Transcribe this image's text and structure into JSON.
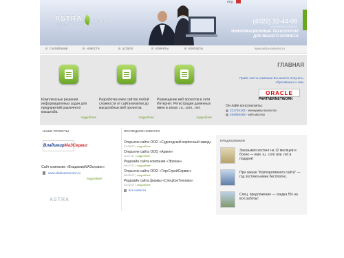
{
  "header": {
    "logo_main": "ASTRA",
    "logo_sub": "COMPANY",
    "logo_systems": "systems",
    "top_icons": [
      "eng"
    ],
    "phone": "(4922) 32-44-09",
    "phone_caption": "контактный телефон",
    "slogan": "ИНФОРМАЦИОННЫЕ ТЕХНОЛОГИИ ДЛЯ ВАШЕГО БИЗНЕСА",
    "site_url": "www.astra-systems.ru"
  },
  "nav": {
    "items": [
      "о компании",
      "новости",
      "услуги",
      "клиенты",
      "контакты"
    ]
  },
  "services": [
    {
      "text": "Комплексные решения информационных задач для предприятий различного масштаба.",
      "more": "подробнее"
    },
    {
      "text": "Разработка www сайтов любой сложности от сайта-визитки до масштабных веб проектов.",
      "more": "подробнее"
    },
    {
      "text": "Размещение веб проектов в сети Интернет. Регистрация доменных имен в зонах .ru, .com, .net.",
      "more": "подробнее"
    }
  ],
  "sidebar": {
    "title": "ГЛАВНАЯ",
    "price_link": "Прайс листы компании Вы можете получить, обратившись к нам.",
    "oracle": "ORACLE",
    "partner": "PARTNERNETWORK",
    "online_title": "Он-лайн консультанты:",
    "contacts": [
      {
        "number": "321746183",
        "role": " - менеджер проектов"
      },
      {
        "number": "484886485",
        "role": " - web мастер"
      }
    ]
  },
  "projects": {
    "title": "НАШИ ПРОЕКТЫ",
    "brand_a": "Владимир",
    "brand_b": "МаЗСервис",
    "caption": "Сайт компании «ВладимирМАЗсервис»",
    "link": "www.vladmazservice.ru",
    "more": "подробнее",
    "footer_logo": "ASTRA"
  },
  "news": {
    "title": "ПОСЛЕДНИЕ НОВОСТИ",
    "items": [
      {
        "title": "Открытие сайта ООО «Судогодский кирпичный завод»",
        "date": "31.08.07",
        "more": "подробнее"
      },
      {
        "title": "Открытие сайта ООО «Арвен»",
        "date": "11.07.07",
        "more": "подробнее"
      },
      {
        "title": "Редизайн сайта компании «Эрихан»",
        "date": "09.07.07",
        "more": "подробнее"
      },
      {
        "title": "Открытие сайта ООО «ТоргСтройСервис»",
        "date": "28.03.07",
        "more": "подробнее"
      },
      {
        "title": "Редизайн сайта фирмы «СпецКонТехника»",
        "date": "22.02.07",
        "more": "подробнее"
      }
    ],
    "all": "все новости"
  },
  "offers": {
    "title": "ПРЕДЛОЖЕНИЯ",
    "items": [
      {
        "text": "Заказывая хостинг на 12 месяцев и более — имя .ru, .com или .net в подарок!",
        "color": "#b5a46a"
      },
      {
        "text": "При заказе \"Корпоративного сайта\" — год хостинга-мини бесплатно.",
        "color": "#5f7fa8"
      },
      {
        "text": "Спец. предложение — скидка 5% на все работы!",
        "color": "#7f9a6f"
      }
    ]
  }
}
